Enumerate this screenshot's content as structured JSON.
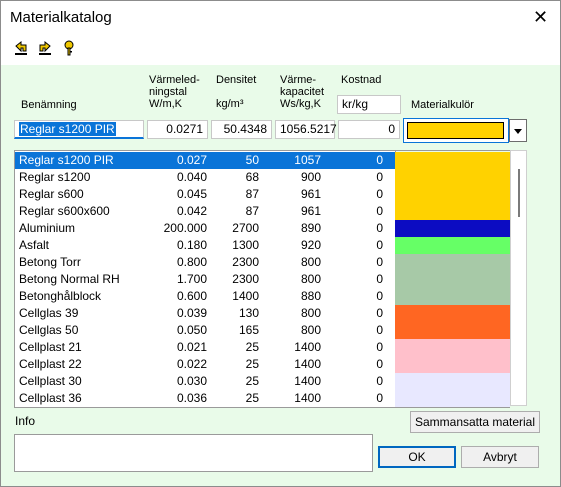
{
  "window": {
    "title": "Materialkatalog",
    "close_glyph": "✕"
  },
  "toolbar": {
    "icons": [
      "undo-arrow-icon",
      "redo-arrow-icon",
      "help-key-icon"
    ]
  },
  "headers": {
    "name": "Benämning",
    "conductivity": [
      "Värmeled-",
      "ningstal",
      "W/m,K"
    ],
    "density": [
      "Densitet",
      "kg/m³"
    ],
    "heatcap": [
      "Värme-",
      "kapacitet",
      "Ws/kg,K"
    ],
    "cost": "Kostnad",
    "cost_unit": "kr/kg",
    "color": "Materialkulör"
  },
  "edit": {
    "name": "Reglar s1200 PIR",
    "conductivity": "0.0271",
    "density": "50.4348",
    "heatcap": "1056.5217",
    "cost": "0",
    "color": "#ffd200"
  },
  "materials": [
    {
      "name": "Reglar s1200 PIR",
      "lambda": "0.027",
      "density": "50",
      "heatcap": "1057",
      "cost": "0",
      "selected": true
    },
    {
      "name": "Reglar s1200",
      "lambda": "0.040",
      "density": "68",
      "heatcap": "900",
      "cost": "0"
    },
    {
      "name": "Reglar s600",
      "lambda": "0.045",
      "density": "87",
      "heatcap": "961",
      "cost": "0"
    },
    {
      "name": "Reglar s600x600",
      "lambda": "0.042",
      "density": "87",
      "heatcap": "961",
      "cost": "0"
    },
    {
      "name": "Aluminium",
      "lambda": "200.000",
      "density": "2700",
      "heatcap": "890",
      "cost": "0"
    },
    {
      "name": "Asfalt",
      "lambda": "0.180",
      "density": "1300",
      "heatcap": "920",
      "cost": "0"
    },
    {
      "name": "Betong Torr",
      "lambda": "0.800",
      "density": "2300",
      "heatcap": "800",
      "cost": "0"
    },
    {
      "name": "Betong Normal RH",
      "lambda": "1.700",
      "density": "2300",
      "heatcap": "800",
      "cost": "0"
    },
    {
      "name": "Betonghålblock",
      "lambda": "0.600",
      "density": "1400",
      "heatcap": "880",
      "cost": "0"
    },
    {
      "name": "Cellglas 39",
      "lambda": "0.039",
      "density": "130",
      "heatcap": "800",
      "cost": "0"
    },
    {
      "name": "Cellglas 50",
      "lambda": "0.050",
      "density": "165",
      "heatcap": "800",
      "cost": "0"
    },
    {
      "name": "Cellplast 21",
      "lambda": "0.021",
      "density": "25",
      "heatcap": "1400",
      "cost": "0"
    },
    {
      "name": "Cellplast 22",
      "lambda": "0.022",
      "density": "25",
      "heatcap": "1400",
      "cost": "0"
    },
    {
      "name": "Cellplast 30",
      "lambda": "0.030",
      "density": "25",
      "heatcap": "1400",
      "cost": "0"
    },
    {
      "name": "Cellplast 36",
      "lambda": "0.036",
      "density": "25",
      "heatcap": "1400",
      "cost": "0"
    }
  ],
  "swatch_colors": [
    "#ffd200",
    "#ffd200",
    "#ffd200",
    "#ffd200",
    "#0c0cc2",
    "#66ff66",
    "#a7c9a7",
    "#a7c9a7",
    "#a7c9a7",
    "#ff6622",
    "#ff6622",
    "#ffc0cb",
    "#ffc0cb",
    "#e8e8ff",
    "#e8e8ff"
  ],
  "info_label": "Info",
  "buttons": {
    "composite": "Sammansatta material",
    "ok": "OK",
    "cancel": "Avbryt"
  }
}
